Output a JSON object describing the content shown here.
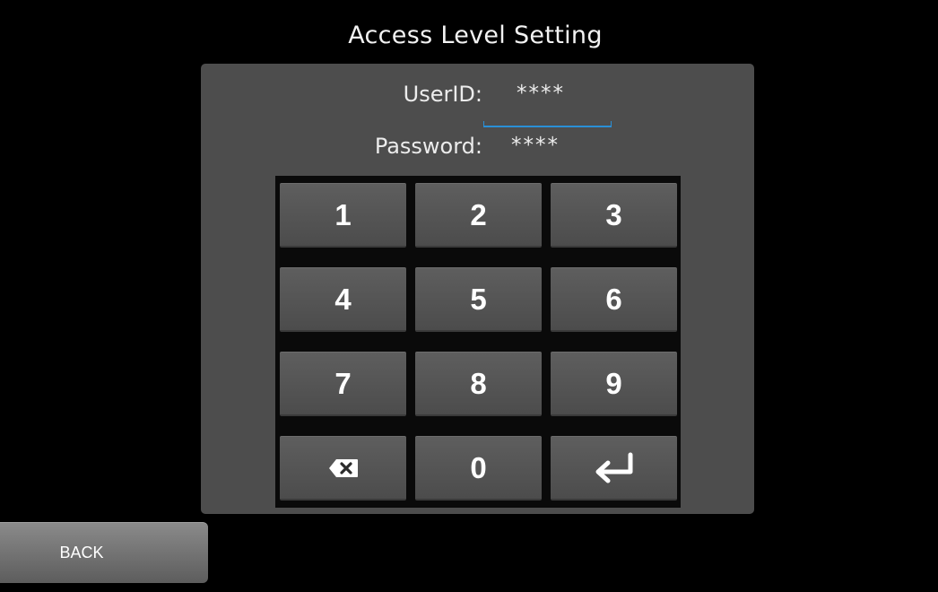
{
  "title": "Access Level Setting",
  "userid": {
    "label": "UserID:",
    "value": "****"
  },
  "password": {
    "label": "Password:",
    "value": "****"
  },
  "keypad": {
    "keys": [
      {
        "label": "1",
        "icon": null
      },
      {
        "label": "2",
        "icon": null
      },
      {
        "label": "3",
        "icon": null
      },
      {
        "label": "4",
        "icon": null
      },
      {
        "label": "5",
        "icon": null
      },
      {
        "label": "6",
        "icon": null
      },
      {
        "label": "7",
        "icon": null
      },
      {
        "label": "8",
        "icon": null
      },
      {
        "label": "9",
        "icon": null
      },
      {
        "label": "",
        "icon": "backspace-icon"
      },
      {
        "label": "0",
        "icon": null
      },
      {
        "label": "",
        "icon": "enter-icon"
      }
    ]
  },
  "back_button": {
    "label": "BACK"
  },
  "colors": {
    "background": "#000000",
    "panel": "#4d4d4d",
    "keypad_bg": "#0a0a0a",
    "key": "#555555",
    "focus_accent": "#2a8fd6",
    "text": "#ececec"
  }
}
